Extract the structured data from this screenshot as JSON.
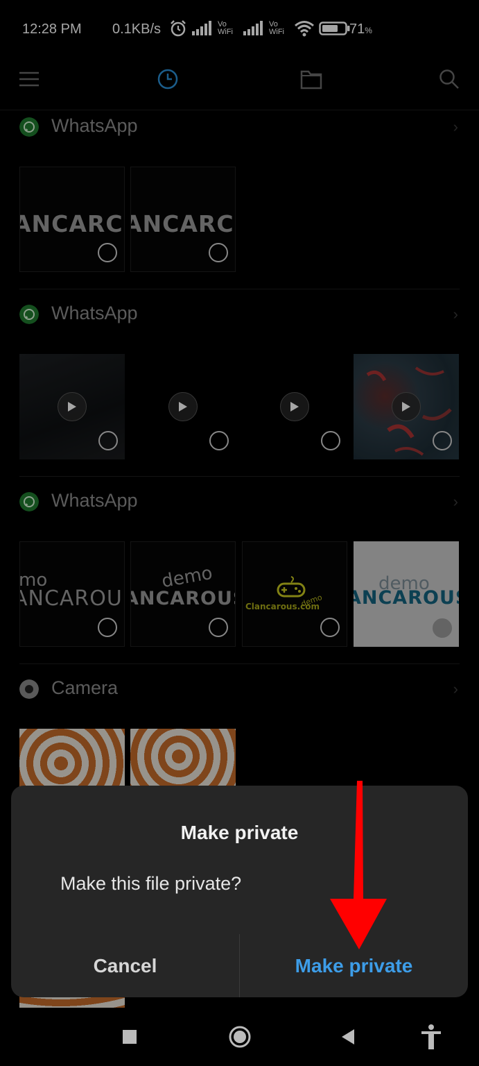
{
  "status_bar": {
    "time": "12:28 PM",
    "net_speed": "0.1KB/s",
    "sim1_label_top": "Vo",
    "sim1_label_bottom": "WiFi",
    "sim2_label_top": "Vo",
    "sim2_label_bottom": "WiFi",
    "battery_level": 71,
    "battery_text": "71",
    "battery_unit": "%"
  },
  "toolbar": {
    "icons": [
      "menu-icon",
      "recent-clock-icon",
      "folder-icon",
      "search-icon"
    ],
    "accent": "#2a8fd6"
  },
  "sections": [
    {
      "app": "WhatsApp",
      "icon": "whatsapp-icon",
      "items": [
        {
          "type": "image",
          "caption": "ANCARC"
        },
        {
          "type": "image",
          "caption": "ANCARC"
        }
      ]
    },
    {
      "app": "WhatsApp",
      "icon": "whatsapp-icon",
      "items": [
        {
          "type": "video"
        },
        {
          "type": "video"
        },
        {
          "type": "video"
        },
        {
          "type": "video"
        }
      ]
    },
    {
      "app": "WhatsApp",
      "icon": "whatsapp-icon",
      "items": [
        {
          "type": "image",
          "caption_demo": "mo",
          "caption": "ANCAROU"
        },
        {
          "type": "image",
          "caption_demo": "demo",
          "caption": "ANCAROUS"
        },
        {
          "type": "image",
          "caption_demo": "demo",
          "caption": "Clancarous.com"
        },
        {
          "type": "image",
          "caption_demo": "demo",
          "caption": "ANCAROUS"
        }
      ]
    },
    {
      "app": "Camera",
      "icon": "camera-icon",
      "items": [
        {
          "type": "image"
        },
        {
          "type": "image"
        }
      ]
    }
  ],
  "dialog": {
    "title": "Make private",
    "message": "Make this file private?",
    "cancel_label": "Cancel",
    "confirm_label": "Make private",
    "confirm_color": "#3d9de8"
  },
  "annotation": {
    "arrow_color": "#ff0000"
  },
  "nav_bar": {
    "icons": [
      "recents-square-icon",
      "home-circle-icon",
      "back-triangle-icon",
      "accessibility-icon"
    ]
  }
}
